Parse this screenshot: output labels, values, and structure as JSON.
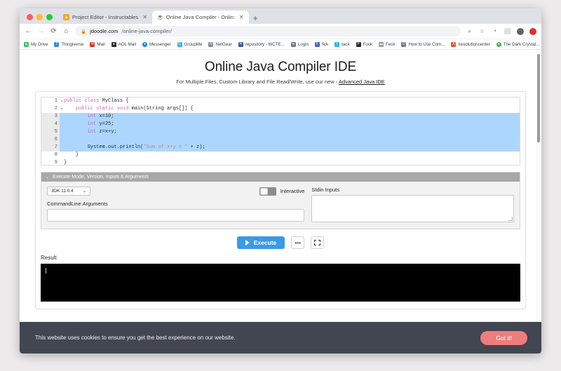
{
  "browser": {
    "tabs": [
      {
        "title": "Project Editor - Instructables",
        "favicon": "instructables-icon",
        "active": false
      },
      {
        "title": "Online Java Compiler - Onlin:",
        "favicon": "jdoodle-icon",
        "active": true
      }
    ],
    "new_tab_label": "+",
    "nav": {
      "back": "←",
      "forward": "→",
      "reload": "⟳",
      "home": "⌂"
    },
    "omnibox": {
      "lock": "🔒",
      "host": "jdoodle.com",
      "path": "/online-java-compiler/"
    },
    "actions": [
      {
        "name": "zoom-search-icon",
        "glyph": "⌕"
      },
      {
        "name": "bookmark-star-icon",
        "glyph": "☆"
      },
      {
        "name": "extension-icon",
        "glyph": "◔"
      },
      {
        "name": "cast-icon",
        "glyph": "⬜"
      },
      {
        "name": "profile-avatar",
        "glyph": ""
      },
      {
        "name": "opera-icon",
        "glyph": ""
      }
    ],
    "bookmarks": [
      {
        "label": "My Drive",
        "color": "#3ec16a"
      },
      {
        "label": "Thingiverse",
        "color": "#2e8fd8"
      },
      {
        "label": "Mail",
        "color": "#d93025"
      },
      {
        "label": "AOL Mail",
        "color": "#2b2b2b"
      },
      {
        "label": "Messenger",
        "color": "#0a84ff"
      },
      {
        "label": "GroupMe",
        "color": "#29b6f6"
      },
      {
        "label": "NetGear",
        "color": "#8a8a8a"
      },
      {
        "label": "repository - WCTE...",
        "color": "#2c5aa0"
      },
      {
        "label": "Login",
        "color": "#7a7a7a"
      },
      {
        "label": "fick",
        "color": "#4a5fc1"
      },
      {
        "label": "tack",
        "color": "#29b6f6"
      },
      {
        "label": "Fock",
        "color": "#2b2b2b"
      },
      {
        "label": "Feck",
        "color": "#9a9a9a"
      },
      {
        "label": "How to Use Com...",
        "color": "#6b7c93"
      },
      {
        "label": "iresolutioncenter",
        "color": "#e8551f"
      },
      {
        "label": "The Dark Crystal...",
        "color": "#3bb54a"
      }
    ],
    "bookmarks_overflow": "»"
  },
  "site": {
    "title": "Online Java Compiler IDE",
    "subtitle_before": "For Multiple Files, Custom Library and File Read/Write, use our new - ",
    "advanced_link": "Advanced Java IDE"
  },
  "editor": {
    "lines": [
      {
        "num": "1",
        "fold": "⌄",
        "selected": false,
        "tokens": [
          {
            "t": "public ",
            "c": "tk-kw"
          },
          {
            "t": "class ",
            "c": "tk-kw"
          },
          {
            "t": "MyClass {",
            "c": "tk-id"
          }
        ]
      },
      {
        "num": "2",
        "fold": "⌄",
        "selected": false,
        "tokens": [
          {
            "t": "    ",
            "c": "tk-plain"
          },
          {
            "t": "public static void ",
            "c": "tk-kw"
          },
          {
            "t": "main(String args[]) {",
            "c": "tk-id"
          }
        ]
      },
      {
        "num": "3",
        "fold": "",
        "selected": true,
        "tokens": [
          {
            "t": "        ",
            "c": "tk-plain"
          },
          {
            "t": "int ",
            "c": "tk-type"
          },
          {
            "t": "x=10;",
            "c": "tk-id"
          }
        ]
      },
      {
        "num": "4",
        "fold": "",
        "selected": true,
        "tokens": [
          {
            "t": "        ",
            "c": "tk-plain"
          },
          {
            "t": "int ",
            "c": "tk-type"
          },
          {
            "t": "y=25;",
            "c": "tk-id"
          }
        ]
      },
      {
        "num": "5",
        "fold": "",
        "selected": true,
        "tokens": [
          {
            "t": "        ",
            "c": "tk-plain"
          },
          {
            "t": "int ",
            "c": "tk-type"
          },
          {
            "t": "z=x+y;",
            "c": "tk-id"
          }
        ]
      },
      {
        "num": "6",
        "fold": "",
        "selected": true,
        "tokens": [
          {
            "t": "",
            "c": "tk-plain"
          }
        ]
      },
      {
        "num": "7",
        "fold": "",
        "selected": true,
        "tokens": [
          {
            "t": "        ",
            "c": "tk-plain"
          },
          {
            "t": "System.out.println(",
            "c": "tk-id"
          },
          {
            "t": "\"Sum of x+y = \"",
            "c": "tk-str"
          },
          {
            "t": " + z);",
            "c": "tk-id"
          }
        ]
      },
      {
        "num": "8",
        "fold": "",
        "selected": false,
        "tokens": [
          {
            "t": "    }",
            "c": "tk-id"
          }
        ]
      },
      {
        "num": "9",
        "fold": "",
        "selected": false,
        "tokens": [
          {
            "t": "}",
            "c": "tk-id"
          }
        ]
      }
    ]
  },
  "exec_panel": {
    "header": "Execute Mode, Version, Inputs & Arguments",
    "collapse_chevron": "⌄",
    "jdk_selected": "JDK 11.0.4",
    "jdk_caret": "⌄",
    "interactive_label": "Interactive",
    "interactive_on": false,
    "cmdline_label": "CommandLine Arguments",
    "cmdline_value": "",
    "stdin_label": "Stdin Inputs",
    "stdin_value": ""
  },
  "actions": {
    "execute_label": "Execute",
    "more_label": "•••",
    "fullscreen_name": "fullscreen-icon"
  },
  "result": {
    "label": "Result",
    "console_output": ""
  },
  "cookie": {
    "message": "This website uses cookies to ensure you get the best experience on our website.",
    "accept_label": "Got it!"
  }
}
